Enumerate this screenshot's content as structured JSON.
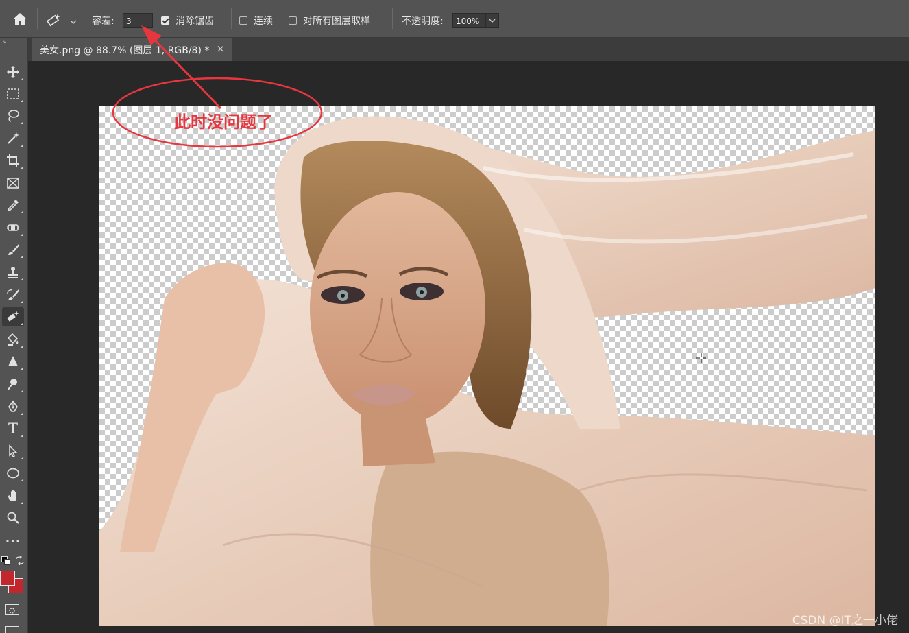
{
  "options_bar": {
    "tolerance_label": "容差:",
    "tolerance_value": "3",
    "antialias_label": "消除锯齿",
    "antialias_checked": true,
    "contiguous_label": "连续",
    "contiguous_checked": false,
    "sample_all_label": "对所有图层取样",
    "sample_all_checked": false,
    "opacity_label": "不透明度:",
    "opacity_value": "100%"
  },
  "document_tab": {
    "title": "美女.png @ 88.7% (图层 1, RGB/8) *",
    "close": "×"
  },
  "toolbar": {
    "tools": [
      "move-tool",
      "marquee-tool",
      "lasso-tool",
      "magic-wand-tool",
      "crop-tool",
      "frame-tool",
      "eyedropper-tool",
      "healing-brush-tool",
      "brush-tool",
      "clone-stamp-tool",
      "history-brush-tool",
      "magic-eraser-tool",
      "paint-bucket-tool",
      "sharpen-tool",
      "dodge-tool",
      "pen-tool",
      "type-tool",
      "path-selection-tool",
      "ellipse-tool",
      "hand-tool",
      "zoom-tool",
      "more-tools"
    ],
    "active_tool": "magic-eraser-tool",
    "type_tool_glyph": "T",
    "more_glyph": "•••"
  },
  "colors": {
    "foreground": "#c1272d",
    "background": "#c1272d",
    "annotation": "#e8363e"
  },
  "annotation": {
    "text": "此时没问题了"
  },
  "watermark": "CSDN @IT之一小佬"
}
